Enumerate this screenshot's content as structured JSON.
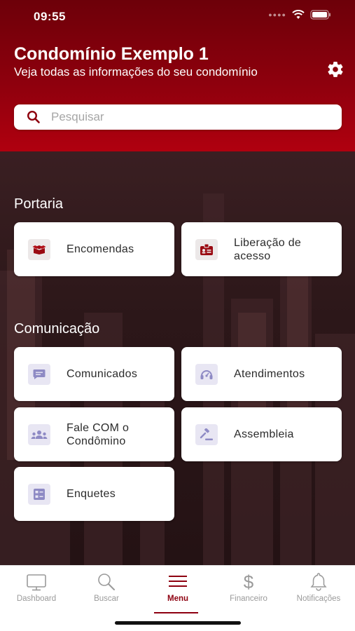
{
  "status_bar": {
    "time": "09:55"
  },
  "header": {
    "title": "Condomínio Exemplo 1",
    "subtitle": "Veja todas as informações do seu condomínio",
    "settings_icon": "gear-icon"
  },
  "search": {
    "placeholder": "Pesquisar",
    "value": ""
  },
  "sections": [
    {
      "title": "Portaria",
      "items": [
        {
          "label": "Encomendas",
          "icon": "package-icon"
        },
        {
          "label": "Liberação de acesso",
          "icon": "id-badge-icon"
        }
      ]
    },
    {
      "title": "Comunicação",
      "items": [
        {
          "label": "Comunicados",
          "icon": "message-icon"
        },
        {
          "label": "Atendimentos",
          "icon": "headset-icon"
        },
        {
          "label": "Fale COM o Condômino",
          "icon": "people-icon"
        },
        {
          "label": "Assembleia",
          "icon": "gavel-icon"
        },
        {
          "label": "Enquetes",
          "icon": "poll-icon"
        }
      ]
    }
  ],
  "tabs": [
    {
      "label": "Dashboard",
      "icon": "monitor-icon",
      "active": false
    },
    {
      "label": "Buscar",
      "icon": "search-icon",
      "active": false
    },
    {
      "label": "Menu",
      "icon": "menu-icon",
      "active": true
    },
    {
      "label": "Financeiro",
      "icon": "dollar-icon",
      "active": false
    },
    {
      "label": "Notificações",
      "icon": "bell-icon",
      "active": false
    }
  ],
  "colors": {
    "brand": "#8e000d",
    "icon_red": "#9a0a12",
    "icon_lavender": "#8e8ac4"
  }
}
